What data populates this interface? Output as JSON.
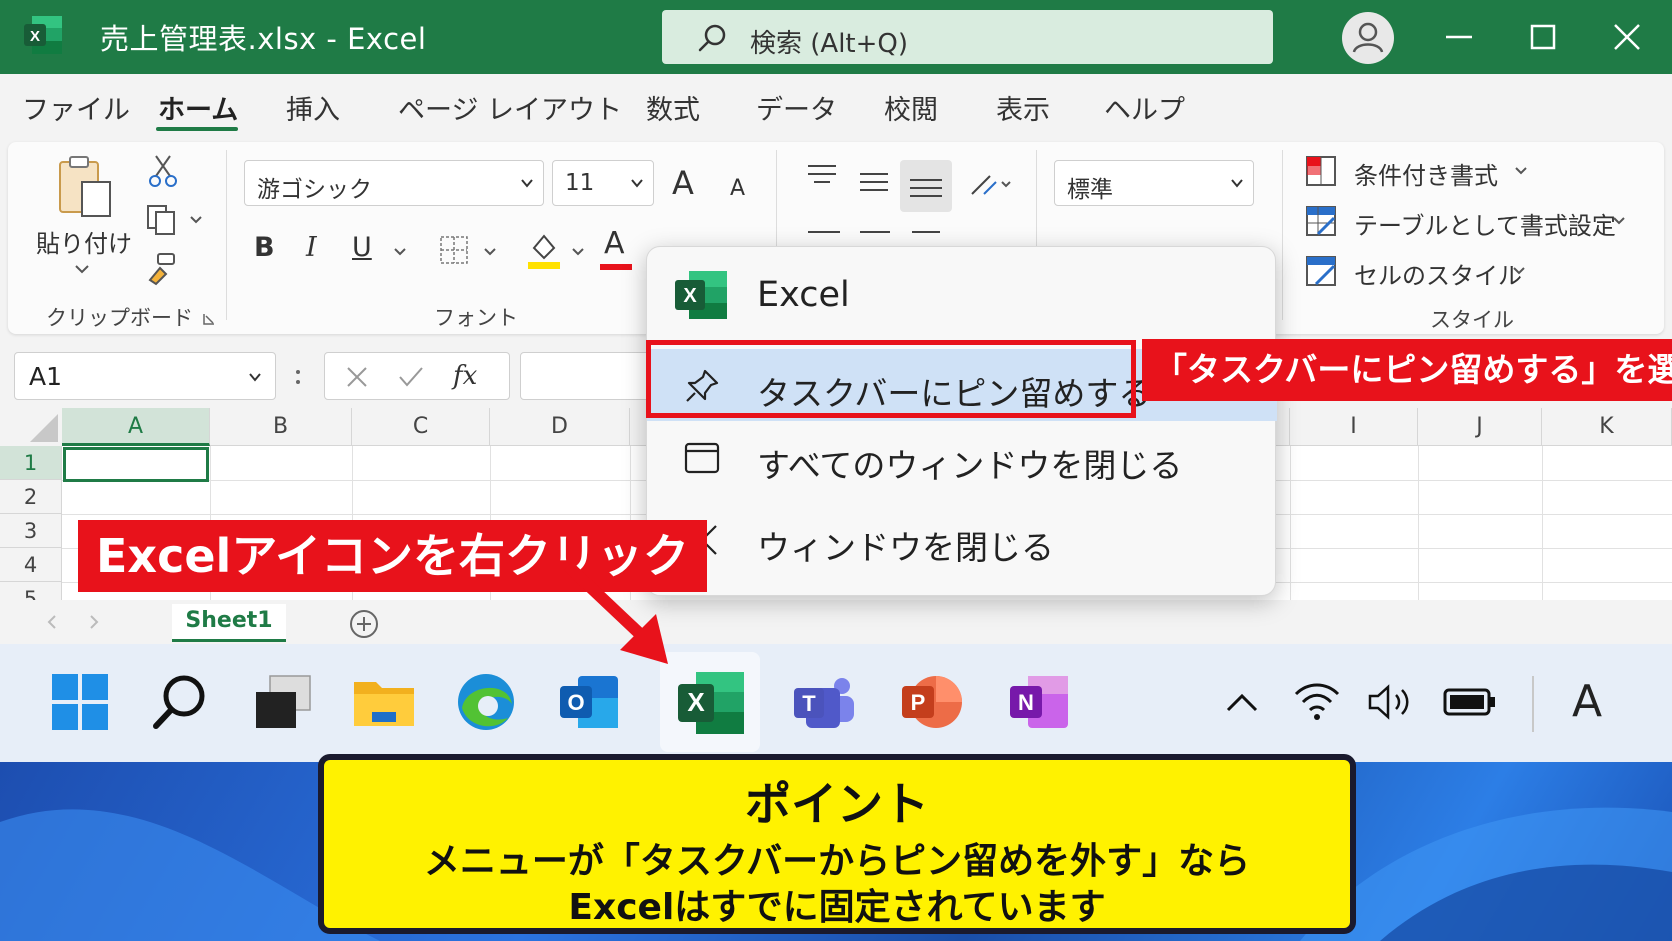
{
  "titlebar": {
    "doc_title": "売上管理表.xlsx  -  Excel",
    "search_placeholder": "検索 (Alt+Q)",
    "app_letter": "X"
  },
  "menu_tabs": [
    {
      "label": "ファイル"
    },
    {
      "label": "ホーム",
      "active": true
    },
    {
      "label": "挿入"
    },
    {
      "label": "ページ レイアウト"
    },
    {
      "label": "数式"
    },
    {
      "label": "データ"
    },
    {
      "label": "校閲"
    },
    {
      "label": "表示"
    },
    {
      "label": "ヘルプ"
    }
  ],
  "ribbon": {
    "clipboard": {
      "paste_label": "貼り付け",
      "group_label": "クリップボード"
    },
    "font": {
      "font_name": "游ゴシック",
      "font_size": "11",
      "bold": "B",
      "italic": "I",
      "underline": "U",
      "font_color_letter": "A",
      "grow": "A",
      "shrink": "A",
      "group_label": "フォント"
    },
    "number": {
      "format": "標準"
    },
    "styles": {
      "items": [
        "条件付き書式",
        "テーブルとして書式設定",
        "セルのスタイル"
      ],
      "group_label": "スタイル"
    }
  },
  "formula_bar": {
    "name_box": "A1",
    "fx": "fx",
    "formula": ""
  },
  "grid": {
    "columns": [
      "A",
      "B",
      "C",
      "D",
      "I",
      "J",
      "K"
    ],
    "rows": [
      "1",
      "2",
      "3",
      "4",
      "5"
    ],
    "selected_cell": "A1"
  },
  "sheets": [
    {
      "name": "Sheet1"
    }
  ],
  "context_menu": {
    "app_name": "Excel",
    "items": [
      {
        "label": "タスクバーにピン留めする",
        "icon": "pin-icon",
        "highlighted": true
      },
      {
        "label": "すべてのウィンドウを閉じる",
        "icon": "window-icon"
      },
      {
        "label": "ウィンドウを閉じる",
        "icon": "close-icon"
      }
    ]
  },
  "taskbar": {
    "apps": [
      "start",
      "search",
      "task-view",
      "file-explorer",
      "edge",
      "outlook",
      "excel",
      "teams",
      "powerpoint",
      "onenote"
    ],
    "letters": {
      "outlook": "O",
      "excel": "X",
      "teams": "T",
      "powerpoint": "P",
      "onenote": "N"
    },
    "ime_indicator": "A"
  },
  "annotations": {
    "select_callout": "「タスクバーにピン留めする」を選択",
    "right_click_callout": "Excelアイコンを右クリック",
    "point_title": "ポイント",
    "point_line1": "メニューが「タスクバーからピン留めを外す」なら",
    "point_line2": "Excelはすでに固定されています"
  },
  "colors": {
    "excel_green": "#1f7b46",
    "annotation_red": "#e8121b",
    "point_yellow": "#fff200",
    "highlight_blue": "#cfe1f6"
  }
}
